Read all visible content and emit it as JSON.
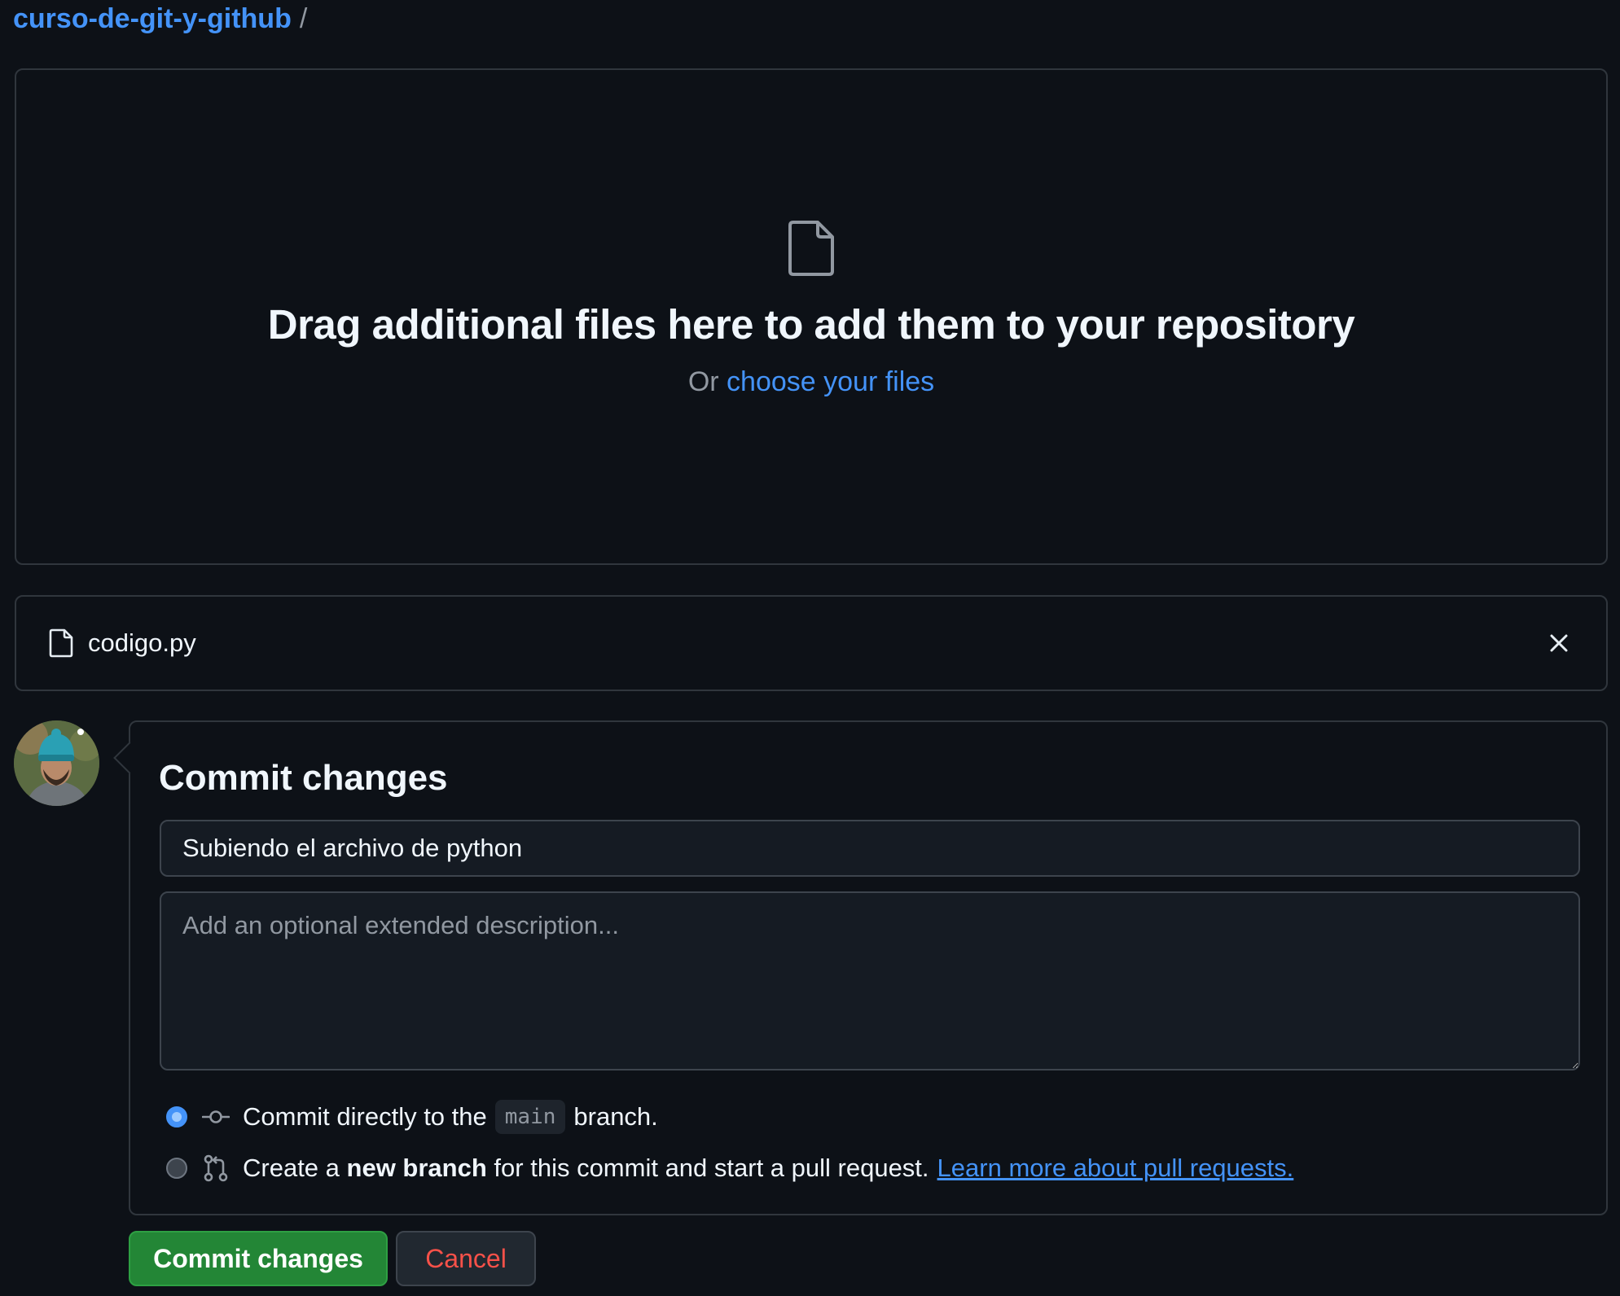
{
  "breadcrumb": {
    "repo": "curso-de-git-y-github",
    "separator": "/"
  },
  "dropzone": {
    "title": "Drag additional files here to add them to your repository",
    "prefix": "Or",
    "link": "choose your files",
    "icon": "file-icon"
  },
  "files": [
    {
      "name": "codigo.py",
      "icon": "file-icon",
      "remove_icon": "close-icon"
    }
  ],
  "commit": {
    "title": "Commit changes",
    "summary_value": "Subiendo el archivo de python",
    "description_placeholder": "Add an optional extended description...",
    "options": {
      "direct": {
        "icon": "git-commit-icon",
        "text_before": "Commit directly to the",
        "branch": "main",
        "text_after": "branch.",
        "checked": true
      },
      "new_branch": {
        "icon": "git-pull-request-icon",
        "text_before": "Create a",
        "bold": "new branch",
        "text_after": "for this commit and start a pull request.",
        "link": "Learn more about pull requests.",
        "checked": false
      }
    }
  },
  "buttons": {
    "commit": "Commit changes",
    "cancel": "Cancel"
  },
  "colors": {
    "background": "#0d1117",
    "link": "#4493f8",
    "primary_button": "#238636",
    "danger_text": "#f85149",
    "border": "#30363d"
  }
}
